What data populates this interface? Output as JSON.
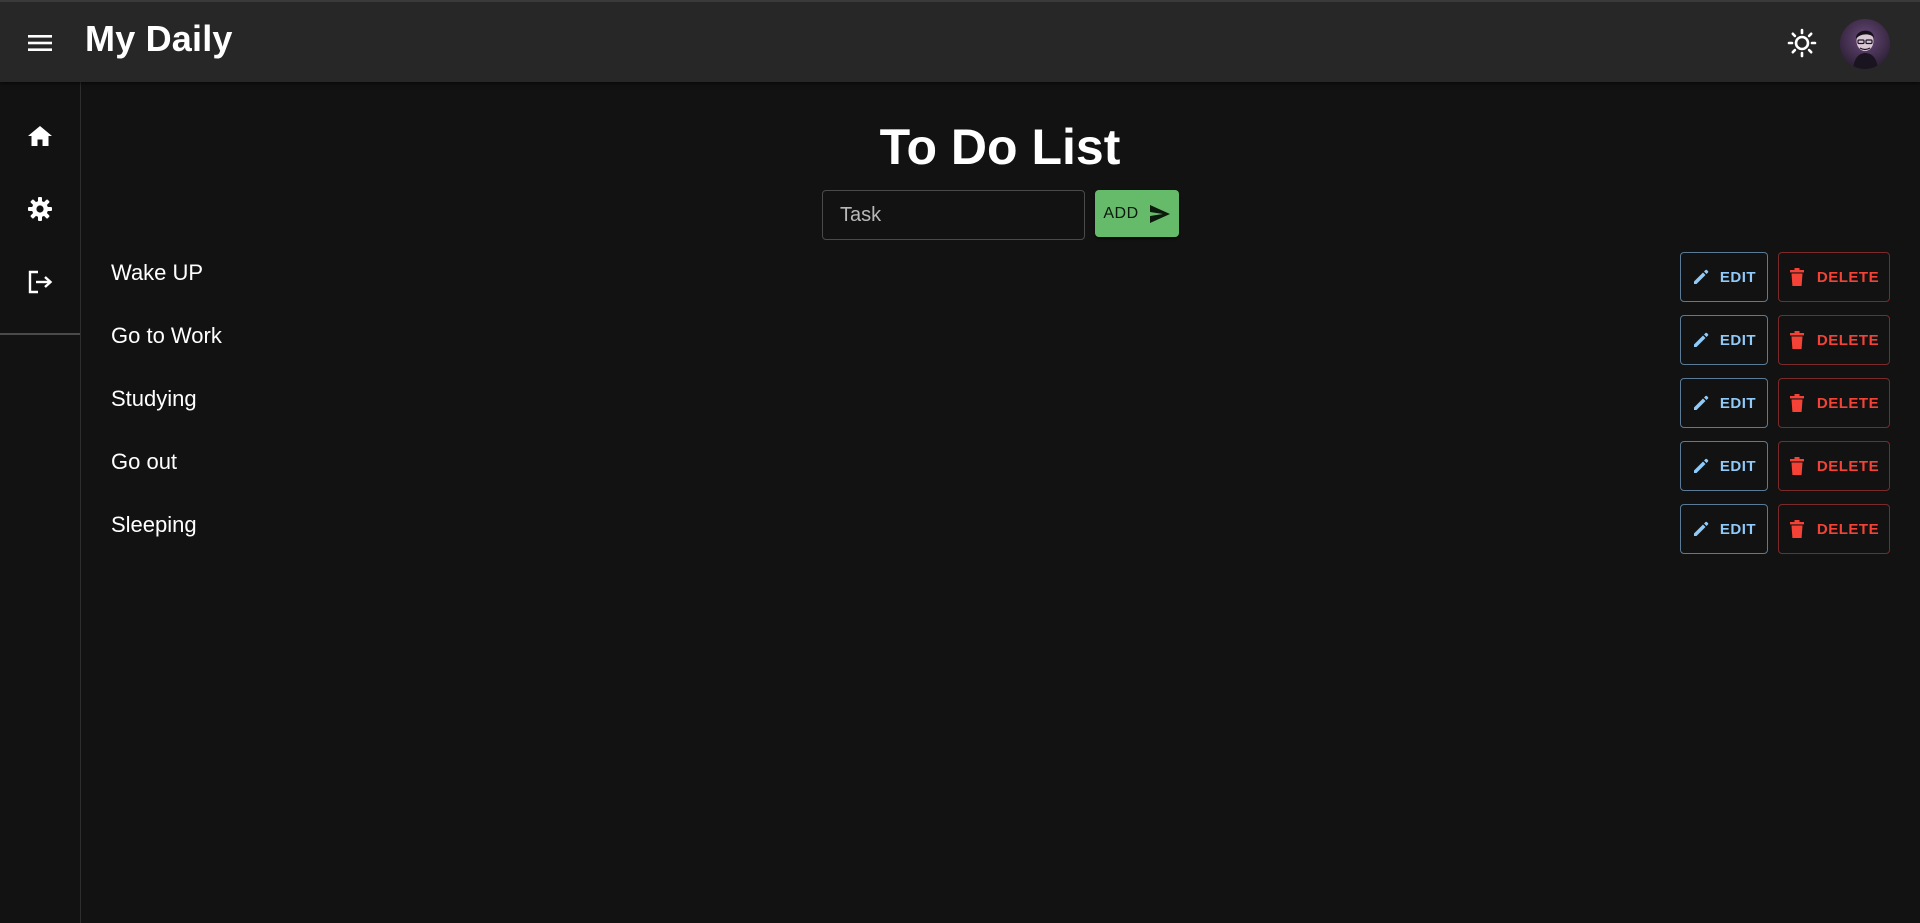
{
  "header": {
    "title": "My Daily",
    "menu_icon": "menu-icon",
    "theme_icon": "sun-icon",
    "avatar_icon": "user-avatar"
  },
  "sidebar": {
    "items": [
      {
        "icon": "home-icon"
      },
      {
        "icon": "gear-icon"
      },
      {
        "icon": "logout-icon"
      }
    ]
  },
  "main": {
    "title": "To Do List",
    "input_placeholder": "Task",
    "input_value": "",
    "add_label": "ADD",
    "edit_label": "EDIT",
    "delete_label": "DELETE",
    "tasks": [
      {
        "text": "Wake UP"
      },
      {
        "text": "Go to Work"
      },
      {
        "text": "Studying"
      },
      {
        "text": "Go out"
      },
      {
        "text": "Sleeping"
      }
    ]
  },
  "colors": {
    "background": "#121212",
    "appbar": "#272727",
    "add_button": "#66bb6a",
    "edit": "#90caf9",
    "delete": "#f44336"
  }
}
